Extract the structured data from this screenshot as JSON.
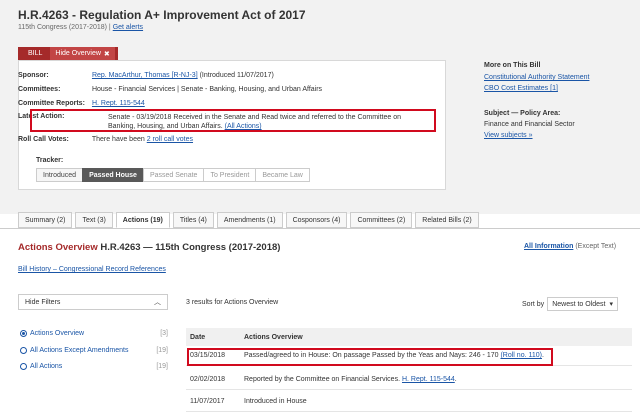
{
  "bill": {
    "title": "H.R.4263 - Regulation A+ Improvement Act of 2017",
    "congress": "115th Congress (2017-2018)",
    "get_alerts": "Get alerts",
    "tab_label": "BILL",
    "hide_overview": "Hide Overview",
    "close_glyph": "✖"
  },
  "overview": {
    "sponsor_key": "Sponsor:",
    "sponsor_link": "Rep. MacArthur, Thomas [R-NJ-3]",
    "sponsor_note": "(Introduced 11/07/2017)",
    "committees_key": "Committees:",
    "committees_val": "House - Financial Services | Senate - Banking, Housing, and Urban Affairs",
    "reports_key": "Committee Reports:",
    "reports_link": "H. Rept. 115-544",
    "latest_key": "Latest Action:",
    "latest_val": "Senate - 03/19/2018 Received in the Senate and Read twice and referred to the Committee on Banking, Housing, and Urban Affairs.",
    "latest_link": "(All Actions)",
    "roll_key": "Roll Call Votes:",
    "roll_pre": "There have been",
    "roll_link": "2 roll call votes",
    "tracker_key": "Tracker:",
    "tracker": [
      "Introduced",
      "Passed House",
      "Passed Senate",
      "To President",
      "Became Law"
    ]
  },
  "side": {
    "more_h": "More on This Bill",
    "more_1": "Constitutional Authority Statement",
    "more_2": "CBO Cost Estimates [1]",
    "subject_h": "Subject — Policy Area:",
    "subject_v": "Finance and Financial Sector",
    "subject_link": "View subjects »"
  },
  "tabs": [
    "Summary (2)",
    "Text (3)",
    "Actions (19)",
    "Titles (4)",
    "Amendments (1)",
    "Cosponsors (4)",
    "Committees (2)",
    "Related Bills (2)"
  ],
  "actions": {
    "title_pre": "Actions Overview",
    "title_bill": "H.R.4263 — 115th Congress (2017-2018)",
    "all_info": "All Information",
    "except_text": "(Except Text)",
    "bill_history": "Bill History – Congressional Record References",
    "hide_filters": "Hide Filters",
    "filters": [
      {
        "label": "Actions Overview",
        "count": "[3]"
      },
      {
        "label": "All Actions Except Amendments",
        "count": "[19]"
      },
      {
        "label": "All Actions",
        "count": "[19]"
      }
    ],
    "results": "3 results for Actions Overview",
    "sort_by": "Sort by",
    "sort_value": "Newest to Oldest",
    "col_date": "Date",
    "col_overview": "Actions Overview",
    "rows": [
      {
        "date": "03/15/2018",
        "text": "Passed/agreed to in House: On passage Passed by the Yeas and Nays: 246 - 170",
        "link": "(Roll no. 110)",
        "tail": "."
      },
      {
        "date": "02/02/2018",
        "text": "Reported by the Committee on Financial Services.",
        "link": "H. Rept. 115-544",
        "tail": "."
      },
      {
        "date": "11/07/2017",
        "text": "Introduced in House",
        "link": "",
        "tail": ""
      }
    ]
  },
  "colors": {
    "accent_red": "#a52a2a",
    "highlight": "#d10a1e",
    "link": "#1a55a6"
  }
}
